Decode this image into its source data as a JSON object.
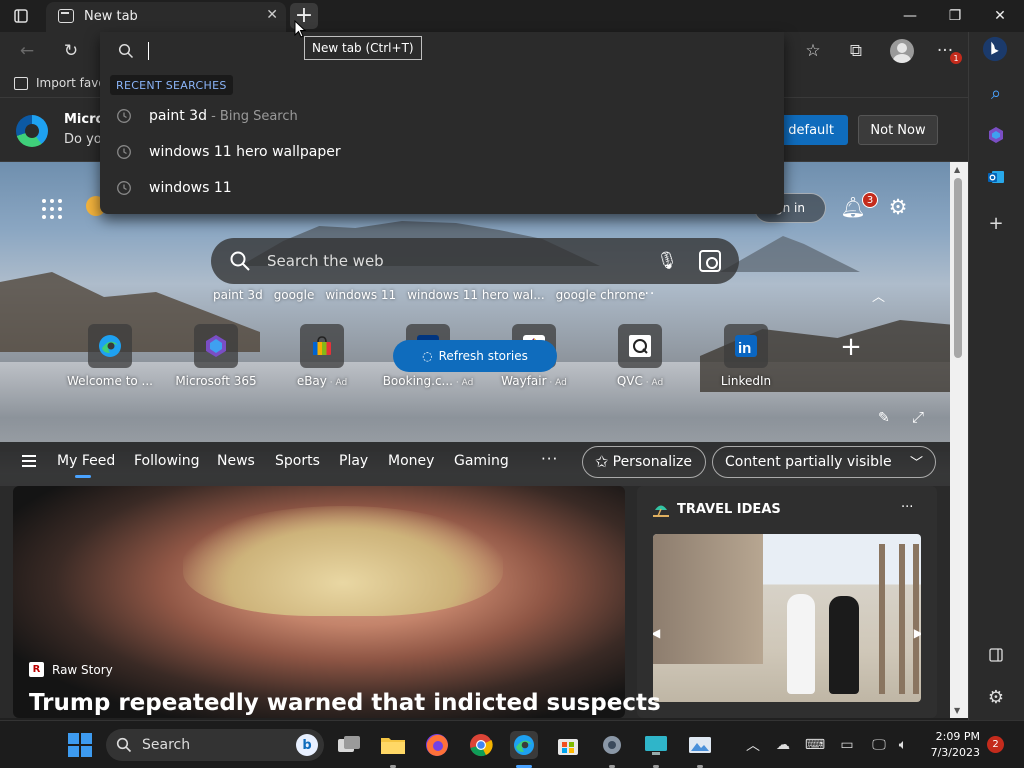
{
  "tab": {
    "title": "New tab",
    "close": "✕"
  },
  "newtab": {
    "icon": "plus-icon",
    "tooltip": "New tab (Ctrl+T)"
  },
  "window_controls": {
    "minimize": "—",
    "restore": "❐",
    "close": "✕"
  },
  "favorites_bar": {
    "import_label": "Import favo"
  },
  "promo": {
    "title": "Micros",
    "subtitle": "Do yo",
    "set_default": "s default",
    "not_now": "Not Now"
  },
  "omnibox": {
    "recent_label": "RECENT SEARCHES",
    "suggestions": [
      {
        "text": "paint 3d",
        "hint": " - Bing Search"
      },
      {
        "text": "windows 11 hero wallpaper",
        "hint": ""
      },
      {
        "text": "windows 11",
        "hint": ""
      }
    ]
  },
  "newtab_page": {
    "sign_in": "gn in",
    "notifications_count": "3",
    "search_placeholder": "Search the web",
    "trending": [
      "paint 3d",
      "google",
      "windows 11",
      "windows 11 hero wal...",
      "google chrome"
    ],
    "trending_more": "···",
    "quick_links": [
      {
        "label": "Welcome to ...",
        "ad": "",
        "icon": "edge-icon",
        "color": "#1ea1f1"
      },
      {
        "label": "Microsoft 365",
        "ad": "",
        "icon": "microsoft-365-icon",
        "color": "#7a4ec4"
      },
      {
        "label": "eBay",
        "ad": " · Ad",
        "icon": "ebay-icon",
        "color": "#e53238"
      },
      {
        "label": "Booking.c...",
        "ad": " · Ad",
        "icon": "booking-icon",
        "color": "#003580"
      },
      {
        "label": "Wayfair",
        "ad": " · Ad",
        "icon": "wayfair-icon",
        "color": "#7f187f"
      },
      {
        "label": "QVC",
        "ad": " · Ad",
        "icon": "qvc-icon",
        "color": "#c9c9c9"
      },
      {
        "label": "LinkedIn",
        "ad": "",
        "icon": "linkedin-icon",
        "color": "#0a66c2"
      }
    ],
    "feed_tabs": [
      "My Feed",
      "Following",
      "News",
      "Sports",
      "Play",
      "Money",
      "Gaming"
    ],
    "feed_more": "···",
    "personalize": "Personalize",
    "content_visibility": "Content partially visible",
    "refresh_stories": "Refresh stories",
    "story": {
      "source": "Raw Story",
      "source_logo": "R",
      "headline": "Trump repeatedly warned that indicted suspects"
    },
    "travel": {
      "title": "TRAVEL IDEAS",
      "more": "···"
    }
  },
  "taskbar": {
    "search_label": "Search",
    "bing_letter": "b",
    "time": "2:09 PM",
    "date": "7/3/2023",
    "notification_count": "2"
  },
  "colors": {
    "accent": "#0f6cbd",
    "badge": "#c42b1c",
    "link_blue": "#8ab4f8"
  }
}
